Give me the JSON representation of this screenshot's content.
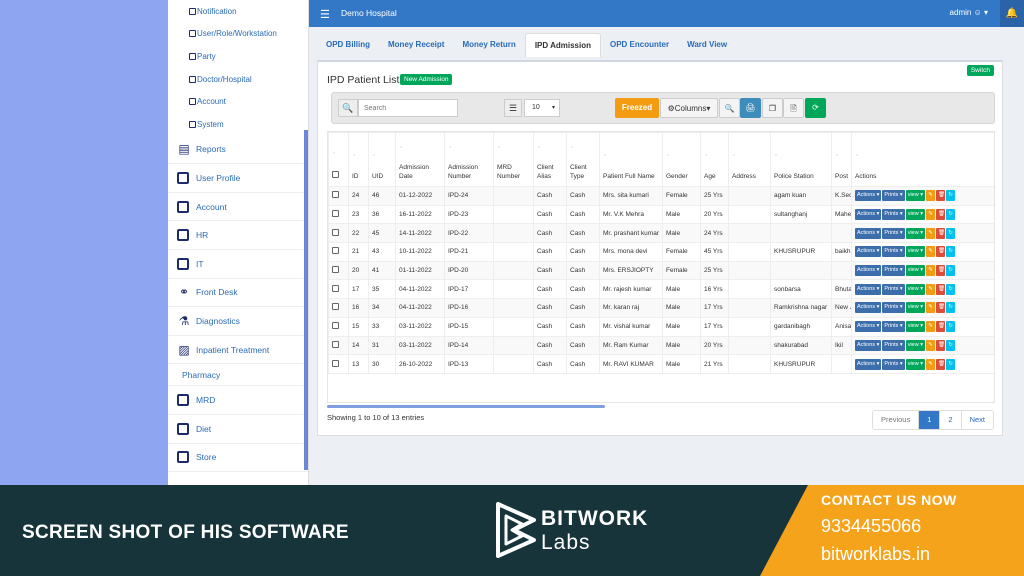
{
  "sidebar": {
    "sub_items": [
      "Notification",
      "User/Role/Workstation",
      "Party",
      "Doctor/Hospital",
      "Account",
      "System"
    ],
    "items": [
      {
        "label": "Reports",
        "icon": "reports-icon"
      },
      {
        "label": "User Profile",
        "icon": "box-icon"
      },
      {
        "label": "Account",
        "icon": "box-icon"
      },
      {
        "label": "HR",
        "icon": "box-icon"
      },
      {
        "label": "IT",
        "icon": "box-icon"
      },
      {
        "label": "Front Desk",
        "icon": "front-desk-icon"
      },
      {
        "label": "Diagnostics",
        "icon": "microscope-icon"
      },
      {
        "label": "Inpatient Treatment",
        "icon": "bed-icon"
      }
    ],
    "pharmacy": "Pharmacy",
    "items2": [
      {
        "label": "MRD"
      },
      {
        "label": "Diet"
      },
      {
        "label": "Store"
      }
    ]
  },
  "header": {
    "hospital": "Demo Hospital",
    "user": "admin"
  },
  "tabs": [
    {
      "label": "OPD Billing",
      "active": false
    },
    {
      "label": "Money Receipt",
      "active": false
    },
    {
      "label": "Money Return",
      "active": false
    },
    {
      "label": "IPD Admission",
      "active": true
    },
    {
      "label": "OPD Encounter",
      "active": false
    },
    {
      "label": "Ward View",
      "active": false
    }
  ],
  "panel": {
    "title": "IPD Patient List",
    "new_admission": "New Admission",
    "switch": "Switch"
  },
  "toolbar": {
    "search_placeholder": "Search",
    "page_size": "10",
    "freezed": "Freezed",
    "columns": "Columns"
  },
  "table": {
    "headers": [
      "ID",
      "UID",
      "Admission Date",
      "Admission Number",
      "MRD Number",
      "Client Alias",
      "Client Type",
      "Patient Full Name",
      "Gender",
      "Age",
      "Address",
      "Police Station",
      "Post",
      "Actions"
    ],
    "action_labels": {
      "actions": "Actions",
      "prints": "Prints",
      "view": "view"
    },
    "rows": [
      [
        "24",
        "46",
        "01-12-2022",
        "IPD-24",
        "",
        "Cash",
        "Cash",
        "Mrs. sita kumari",
        "Female",
        "25 Yrs",
        "",
        "agam kuan",
        "K.Sec"
      ],
      [
        "23",
        "36",
        "16-11-2022",
        "IPD-23",
        "",
        "Cash",
        "Cash",
        "Mr. V.K Mehra",
        "Male",
        "20 Yrs",
        "",
        "sultanghanj",
        "Mahe"
      ],
      [
        "22",
        "45",
        "14-11-2022",
        "IPD-22",
        "",
        "Cash",
        "Cash",
        "Mr. prashant kumar",
        "Male",
        "24 Yrs",
        "",
        "",
        ""
      ],
      [
        "21",
        "43",
        "10-11-2022",
        "IPD-21",
        "",
        "Cash",
        "Cash",
        "Mrs. mona devi",
        "Female",
        "45 Yrs",
        "",
        "KHUSRUPUR",
        "baikh"
      ],
      [
        "20",
        "41",
        "01-11-2022",
        "IPD-20",
        "",
        "Cash",
        "Cash",
        "Mrs. ERSJIOPTY",
        "Female",
        "25 Yrs",
        "",
        "",
        ""
      ],
      [
        "17",
        "35",
        "04-11-2022",
        "IPD-17",
        "",
        "Cash",
        "Cash",
        "Mr. rajesh kumar",
        "Male",
        "16 Yrs",
        "",
        "sonbarsa",
        "Bhuta"
      ],
      [
        "16",
        "34",
        "04-11-2022",
        "IPD-16",
        "",
        "Cash",
        "Cash",
        "Mr. karan raj",
        "Male",
        "17 Yrs",
        "",
        "Ramkrishna nagar",
        "New J"
      ],
      [
        "15",
        "33",
        "03-11-2022",
        "IPD-15",
        "",
        "Cash",
        "Cash",
        "Mr. vishal kumar",
        "Male",
        "17 Yrs",
        "",
        "gardanibagh",
        "Anisa"
      ],
      [
        "14",
        "31",
        "03-11-2022",
        "IPD-14",
        "",
        "Cash",
        "Cash",
        "Mr. Ram Kumar",
        "Male",
        "20 Yrs",
        "",
        "shakurabad",
        "Ikil"
      ],
      [
        "13",
        "30",
        "26-10-2022",
        "IPD-13",
        "",
        "Cash",
        "Cash",
        "Mr. RAVI KUMAR",
        "Male",
        "21 Yrs",
        "",
        "KHUSRUPUR",
        ""
      ]
    ]
  },
  "footer": {
    "showing": "Showing 1 to 10 of 13 entries",
    "pages": [
      "Previous",
      "1",
      "2",
      "Next"
    ],
    "current_page": "1"
  },
  "banner": {
    "caption": "SCREEN SHOT OF HIS SOFTWARE",
    "logo_line1": "BITWORK",
    "logo_line2": "Labs",
    "contact_title": "CONTACT US NOW",
    "phone": "9334455066",
    "website": "bitworklabs.in",
    "colors": {
      "dark": "#17343a",
      "orange": "#f5a31a"
    }
  }
}
